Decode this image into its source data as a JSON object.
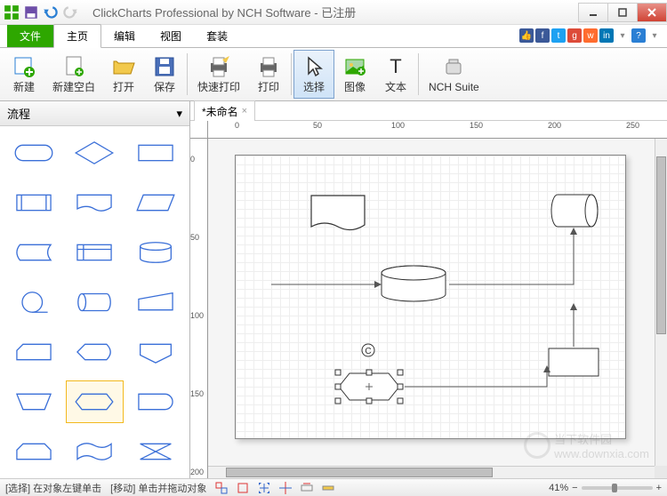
{
  "window": {
    "title": "ClickCharts Professional by NCH Software - 已注册"
  },
  "ribbon": {
    "file": "文件",
    "tabs": [
      "主页",
      "编辑",
      "视图",
      "套装"
    ],
    "active_tab": 0
  },
  "toolbar": {
    "new": "新建",
    "new_blank": "新建空白",
    "open": "打开",
    "save": "保存",
    "quick_print": "快速打印",
    "print": "打印",
    "select": "选择",
    "image": "图像",
    "text": "文本",
    "nch_suite": "NCH Suite"
  },
  "shapes_panel": {
    "header": "流程"
  },
  "document": {
    "tab_title": "*未命名"
  },
  "ruler": {
    "h_ticks": [
      "0",
      "50",
      "100",
      "150",
      "200",
      "250"
    ],
    "v_ticks": [
      "0",
      "50",
      "100",
      "150",
      "200"
    ]
  },
  "statusbar": {
    "hint_select": "[选择] 在对象左键单击",
    "hint_move": "[移动] 单击并拖动对象",
    "zoom": "41%"
  },
  "watermark": {
    "text": "当下软件园",
    "url": "www.downxia.com"
  }
}
